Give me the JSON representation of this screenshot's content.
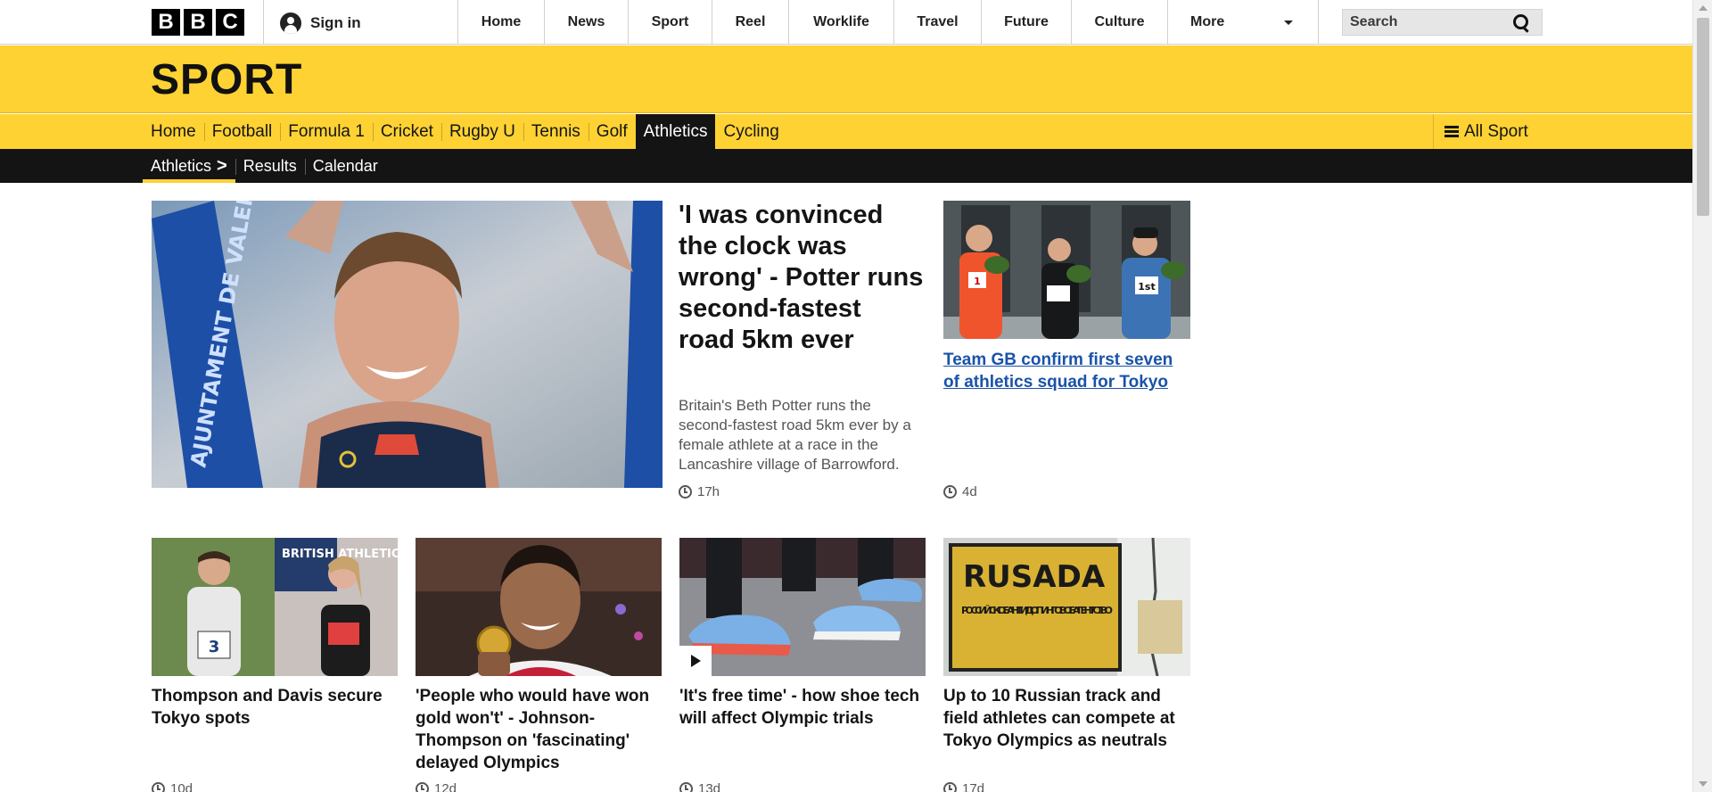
{
  "header": {
    "logo_letters": [
      "B",
      "B",
      "C"
    ],
    "signin_label": "Sign in",
    "nav": [
      "Home",
      "News",
      "Sport",
      "Reel",
      "Worklife",
      "Travel",
      "Future",
      "Culture",
      "More"
    ],
    "search_placeholder": "Search"
  },
  "sport": {
    "title": "SPORT",
    "nav": [
      "Home",
      "Football",
      "Formula 1",
      "Cricket",
      "Rugby U",
      "Tennis",
      "Golf",
      "Athletics",
      "Cycling"
    ],
    "active_nav": "Athletics",
    "all_sport_label": "All Sport",
    "subnav": [
      "Athletics",
      "Results",
      "Calendar"
    ]
  },
  "lead_story": {
    "headline": "'I was convinced the clock was wrong' - Potter runs second-fastest road 5km ever",
    "summary": "Britain's Beth Potter runs the second-fastest road 5km ever by a female athlete at a race in the Lancashire village of Barrowford.",
    "time": "17h"
  },
  "side_story": {
    "headline": "Team GB confirm first seven of athletics squad for Tokyo",
    "time": "4d"
  },
  "cards": [
    {
      "headline": "Thompson and Davis secure Tokyo spots",
      "time": "10d"
    },
    {
      "headline": "'People who would have won gold won't' - Johnson-Thompson on 'fascinating' delayed Olympics",
      "time": "12d"
    },
    {
      "headline": "'It's free time' - how shoe tech will affect Olympic trials",
      "time": "13d"
    },
    {
      "headline": "Up to 10 Russian track and field athletes can compete at Tokyo Olympics as neutrals",
      "time": "17d"
    }
  ],
  "image_text": {
    "banner_lead": "AJUNTAMENT DE VALENCIA",
    "bib_side_1": "1",
    "bib_side_2": "1st",
    "card1_bib": "3",
    "card1_banner": "BRITISH ATHLETICS",
    "rusada_sign_title": "RUSADA",
    "rusada_sign_body": "РОССИЙСКОЕ АНТИДОПИНГОВОЕ АГЕНТСТВО"
  },
  "colors": {
    "sport_yellow": "#fed233",
    "subnav_black": "#141414",
    "link_blue": "#1a53a8"
  }
}
